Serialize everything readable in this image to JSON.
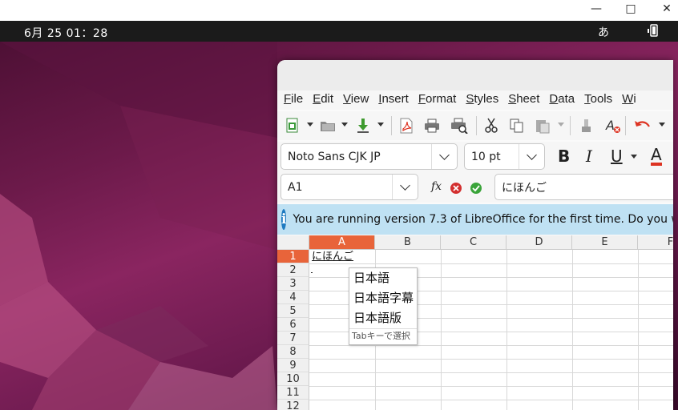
{
  "window_controls": {
    "minimize": "—",
    "maximize": "□",
    "close": "✕"
  },
  "topbar": {
    "clock": "6月 25 01：28",
    "input_method": "あ"
  },
  "menubar": {
    "items": [
      {
        "label": "File",
        "key": "F",
        "rest": "ile"
      },
      {
        "label": "Edit",
        "key": "E",
        "rest": "dit"
      },
      {
        "label": "View",
        "key": "V",
        "rest": "iew"
      },
      {
        "label": "Insert",
        "key": "I",
        "rest": "nsert"
      },
      {
        "label": "Format",
        "key": "F",
        "rest": "ormat"
      },
      {
        "label": "Styles",
        "key": "S",
        "rest": "tyles"
      },
      {
        "label": "Sheet",
        "key": "S",
        "rest": "heet"
      },
      {
        "label": "Data",
        "key": "D",
        "rest": "ata"
      },
      {
        "label": "Tools",
        "key": "T",
        "rest": "ools"
      },
      {
        "label": "Wi",
        "key": "W",
        "rest": "i"
      }
    ]
  },
  "format_bar": {
    "font_name": "Noto Sans CJK JP",
    "font_size": "10 pt",
    "bold": "B",
    "italic": "I",
    "underline": "U",
    "font_color": "A"
  },
  "formula_bar": {
    "name_box": "A1",
    "function_glyph": "fx",
    "content": "にほんご"
  },
  "infobar": {
    "message": "You are running version 7.3 of LibreOffice for the first time. Do you w"
  },
  "sheet": {
    "columns": [
      "A",
      "B",
      "C",
      "D",
      "E",
      "F"
    ],
    "rows": [
      "1",
      "2",
      "3",
      "4",
      "5",
      "6",
      "7",
      "8",
      "9",
      "10",
      "11",
      "12"
    ],
    "cell_a1": "にほんご",
    "selected_column": "A",
    "selected_row": "1"
  },
  "ime_candidates": {
    "items": [
      "日本語",
      "日本語字幕",
      "日本語版"
    ],
    "footer": "Tabキーで選択"
  },
  "colors": {
    "accent": "#e8643a",
    "infobar": "#bfe1f3",
    "topbar": "#1b1b1b"
  }
}
